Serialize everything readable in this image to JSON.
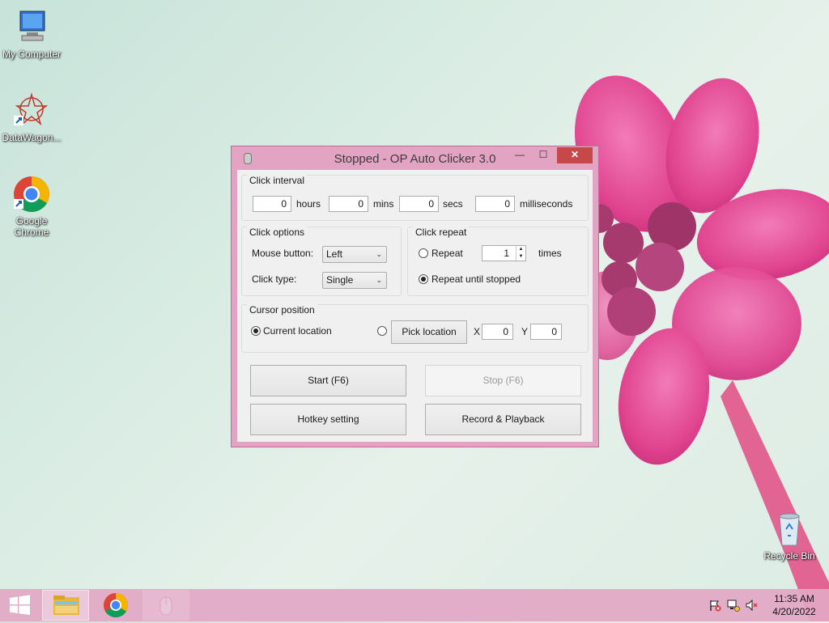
{
  "desktop": {
    "icons": [
      {
        "label": "My Computer"
      },
      {
        "label": "DataWagon..."
      },
      {
        "label": "Google Chrome"
      },
      {
        "label": "Recycle Bin"
      }
    ]
  },
  "window": {
    "title": "Stopped - OP Auto Clicker 3.0",
    "controls": {
      "minimize": "—",
      "maximize": "☐",
      "close": "✕"
    },
    "click_interval": {
      "label": "Click interval",
      "hours": {
        "value": "0",
        "unit": "hours"
      },
      "mins": {
        "value": "0",
        "unit": "mins"
      },
      "secs": {
        "value": "0",
        "unit": "secs"
      },
      "milliseconds": {
        "value": "0",
        "unit": "milliseconds"
      }
    },
    "click_options": {
      "label": "Click options",
      "mouse_button_label": "Mouse button:",
      "mouse_button_value": "Left",
      "click_type_label": "Click type:",
      "click_type_value": "Single"
    },
    "click_repeat": {
      "label": "Click repeat",
      "repeat_label": "Repeat",
      "repeat_count": "1",
      "times_label": "times",
      "until_stopped_label": "Repeat until stopped",
      "selected": "until_stopped"
    },
    "cursor_position": {
      "label": "Cursor position",
      "current_location_label": "Current location",
      "pick_location_label": "Pick location",
      "x_label": "X",
      "x_value": "0",
      "y_label": "Y",
      "y_value": "0",
      "selected": "current"
    },
    "buttons": {
      "start": "Start (F6)",
      "stop": "Stop (F6)",
      "hotkey": "Hotkey setting",
      "record": "Record & Playback"
    }
  },
  "taskbar": {
    "time": "11:35 AM",
    "date": "4/20/2022",
    "apps": [
      "start-icon",
      "file-explorer-icon",
      "chrome-icon",
      "mouse-app-icon"
    ]
  },
  "colors": {
    "accent": "#e2a4c2",
    "close": "#c74848"
  }
}
